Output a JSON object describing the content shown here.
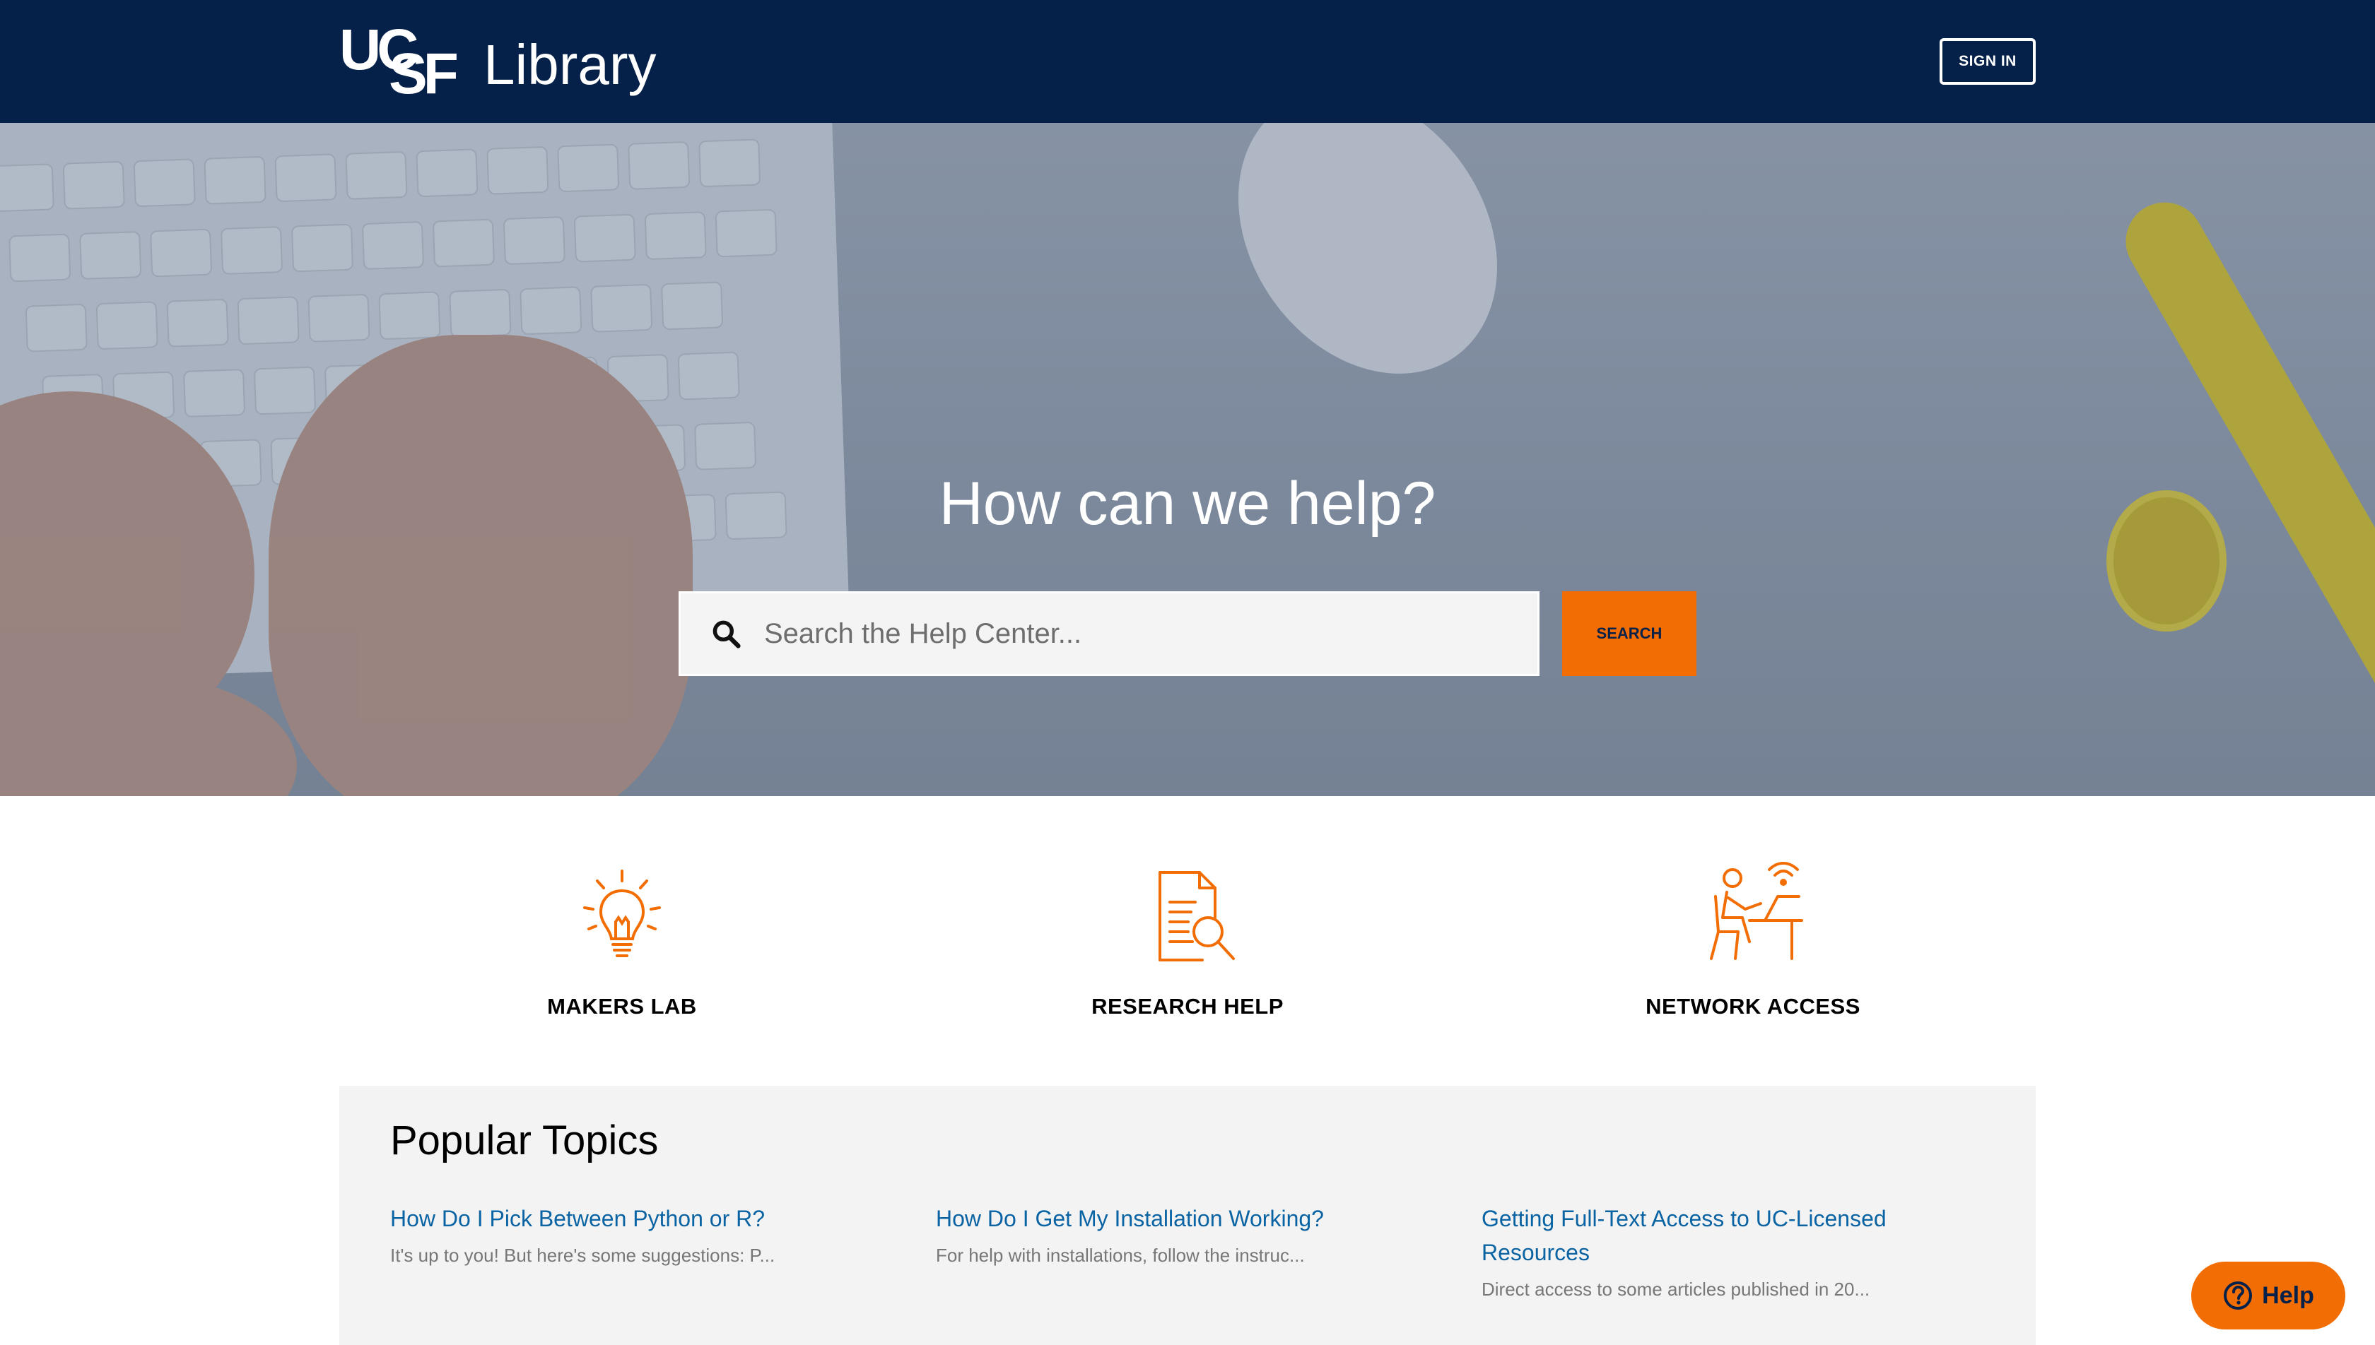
{
  "header": {
    "logo_mark_top": "UC",
    "logo_mark_bottom": "SF",
    "logo_text": "Library",
    "sign_in_label": "SIGN IN"
  },
  "hero": {
    "title": "How can we help?",
    "search": {
      "placeholder": "Search the Help Center...",
      "value": "",
      "button_label": "SEARCH"
    }
  },
  "categories": [
    {
      "label": "MAKERS LAB",
      "icon": "lightbulb-icon"
    },
    {
      "label": "RESEARCH HELP",
      "icon": "document-search-icon"
    },
    {
      "label": "NETWORK ACCESS",
      "icon": "person-desk-wifi-icon"
    }
  ],
  "popular": {
    "title": "Popular Topics",
    "topics": [
      {
        "title": "How Do I Pick Between Python or R?",
        "excerpt": "It's up to you! But here's some suggestions: P..."
      },
      {
        "title": "How Do I Get My Installation Working?",
        "excerpt": "For help with installations, follow the instruc..."
      },
      {
        "title": "Getting Full-Text Access to UC-Licensed Resources",
        "excerpt": "Direct access to some articles published in 20..."
      }
    ]
  },
  "help_widget": {
    "label": "Help",
    "icon": "question-circle-icon"
  },
  "colors": {
    "navy": "#052049",
    "accent_orange": "#f26d04",
    "link_blue": "#0a63a3",
    "panel_gray": "#f3f3f3"
  }
}
